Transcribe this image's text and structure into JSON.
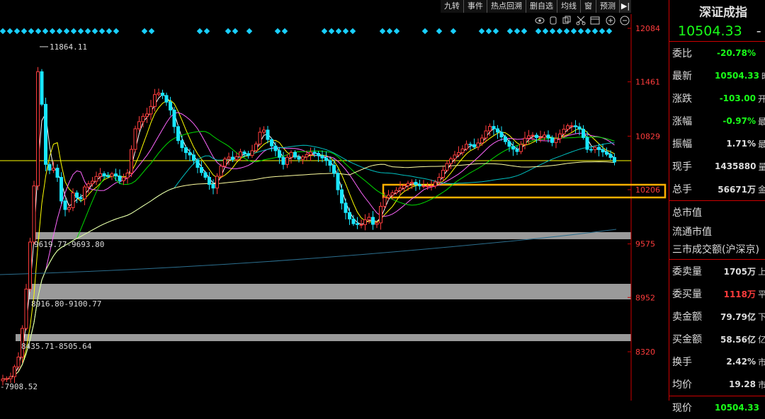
{
  "toolbar": {
    "buttons": [
      "九转",
      "事件",
      "热点回溯",
      "删自选",
      "均线",
      "窗",
      "预测"
    ],
    "arrow": "▶|"
  },
  "chart": {
    "price_levels": [
      "12084",
      "11461",
      "10829",
      "10206",
      "9575",
      "8952",
      "8320"
    ],
    "high_label": "11864.11",
    "low_label": "-7908.52",
    "zone_labels": [
      "9619.77-9693.80",
      "8916.80-9100.77",
      "8435.71-8505.64"
    ],
    "icons": [
      "eye-icon",
      "hand-icon",
      "copy-icon",
      "cut-icon",
      "calendar-icon",
      "zoom-in-icon",
      "zoom-out-icon"
    ],
    "colors": {
      "up": "#ff3c3c",
      "down": "#19e6ff",
      "ma5": "#ffffff",
      "ma10": "#ffff00",
      "ma20": "#ff66ff",
      "ma30": "#00dd00",
      "ma60": "#00c0c0",
      "ma120": "#ffffa0"
    }
  },
  "panel": {
    "title": "深证成指",
    "price": "10504.33",
    "price_tail": "-",
    "rows": [
      {
        "label": "委比",
        "value": "-20.78%",
        "tail": "",
        "color": "grn"
      },
      {
        "label": "最新",
        "value": "10504.33",
        "tail": "昨",
        "color": "grn"
      },
      {
        "label": "涨跌",
        "value": "-103.00",
        "tail": "开",
        "color": "grn"
      },
      {
        "label": "涨幅",
        "value": "-0.97%",
        "tail": "最",
        "color": "grn"
      },
      {
        "label": "振幅",
        "value": "1.71%",
        "tail": "最",
        "color": "wht"
      },
      {
        "label": "现手",
        "value": "1435880",
        "tail": "量",
        "color": "wht"
      },
      {
        "label": "总手",
        "value": "56671万",
        "tail": "金",
        "color": "wht"
      }
    ],
    "info": [
      "总市值",
      "流通市值",
      "三市成交额(沪深京)"
    ],
    "rows2": [
      {
        "label": "委卖量",
        "value": "1705万",
        "tail": "上",
        "color": "wht"
      },
      {
        "label": "委买量",
        "value": "1118万",
        "tail": "平",
        "color": "red"
      },
      {
        "label": "卖金额",
        "value": "79.79亿",
        "tail": "下",
        "color": "wht"
      },
      {
        "label": "买金额",
        "value": "58.56亿",
        "tail": "亿",
        "color": "wht"
      },
      {
        "label": "换手",
        "value": "2.42%",
        "tail": "市",
        "color": "wht"
      },
      {
        "label": "均价",
        "value": "19.28",
        "tail": "市",
        "color": "wht"
      }
    ],
    "last": {
      "label": "现价",
      "value": "10504.33",
      "color": "grn"
    }
  }
}
